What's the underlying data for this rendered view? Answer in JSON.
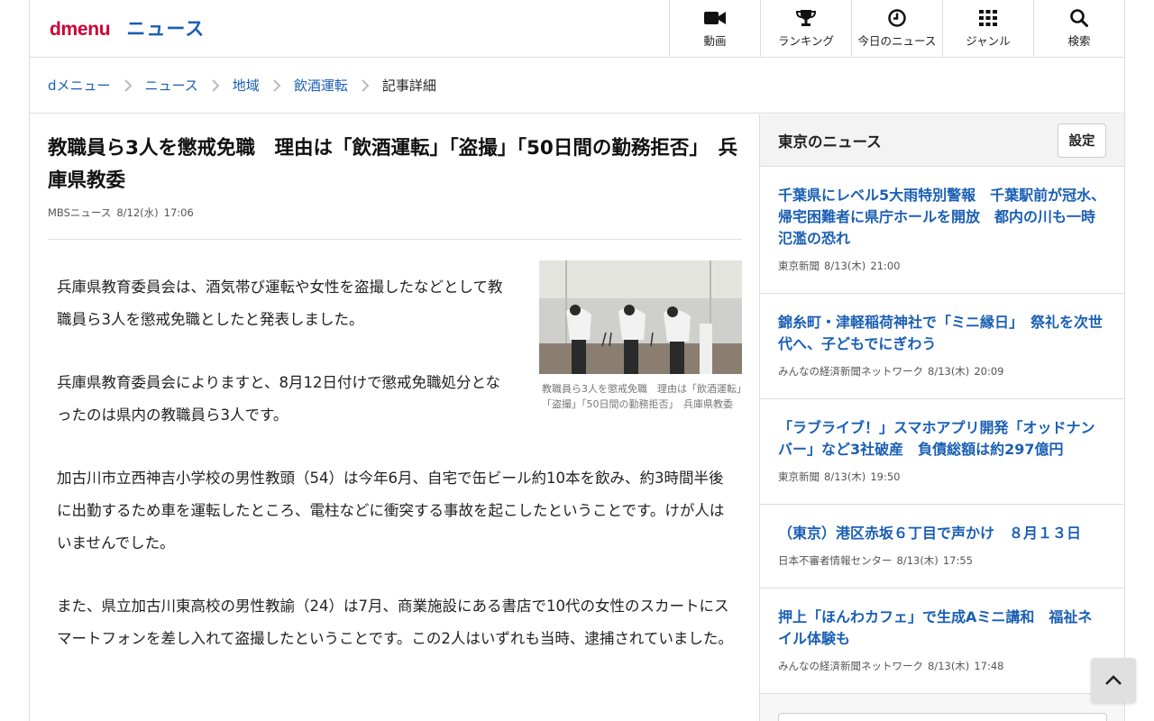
{
  "header": {
    "logo": "dmenu",
    "section": "ニュース",
    "nav": [
      {
        "label": "動画",
        "icon": "video-camera-icon"
      },
      {
        "label": "ランキング",
        "icon": "trophy-icon"
      },
      {
        "label": "今日のニュース",
        "icon": "clock-icon"
      },
      {
        "label": "ジャンル",
        "icon": "grid-icon"
      },
      {
        "label": "検索",
        "icon": "search-icon"
      }
    ]
  },
  "breadcrumb": [
    "dメニュー",
    "ニュース",
    "地域",
    "飲酒運転",
    "記事詳細"
  ],
  "article": {
    "headline": "教職員ら3人を懲戒免職　理由は「飲酒運転」「盗撮」「50日間の勤務拒否」　兵庫県教委",
    "source": "MBSニュース",
    "date": "8/12(水)",
    "time": "17:06",
    "image_caption": "教職員ら3人を懲戒免職　理由は「飲酒運転」「盗撮」「50日間の勤務拒否」　兵庫県教委",
    "paragraphs": [
      "兵庫県教育委員会は、酒気帯び運転や女性を盗撮したなどとして教職員ら3人を懲戒免職としたと発表しました。",
      "兵庫県教育委員会によりますと、8月12日付けで懲戒免職処分となったのは県内の教職員ら3人です。",
      "加古川市立西神吉小学校の男性教頭（54）は今年6月、自宅で缶ビール約10本を飲み、約3時間半後に出勤するため車を運転したところ、電柱などに衝突する事故を起こしたということです。けが人はいませんでした。",
      "また、県立加古川東高校の男性教諭（24）は7月、商業施設にある書店で10代の女性のスカートにスマートフォンを差し入れて盗撮したということです。この2人はいずれも当時、逮捕されていました。"
    ]
  },
  "sidebar": {
    "title": "東京のニュース",
    "settings_label": "設定",
    "items": [
      {
        "title": "千葉県にレベル5大雨特別警報　千葉駅前が冠水、帰宅困難者に県庁ホールを開放　都内の川も一時氾濫の恐れ",
        "source": "東京新聞",
        "date": "8/13(木)",
        "time": "21:00"
      },
      {
        "title": "錦糸町・津軽稲荷神社で「ミニ縁日」　祭礼を次世代へ、子どもでにぎわう",
        "source": "みんなの経済新聞ネットワーク",
        "date": "8/13(木)",
        "time": "20:09"
      },
      {
        "title": "「ラブライブ！」スマホアプリ開発「オッドナンバー」など3社破産　負債総額は約297億円",
        "source": "東京新聞",
        "date": "8/13(木)",
        "time": "19:50"
      },
      {
        "title": "（東京）港区赤坂６丁目で声かけ　８月１３日",
        "source": "日本不審者情報センター",
        "date": "8/13(木)",
        "time": "17:55"
      },
      {
        "title": "押上「ほんわカフェ」で生成Aミニ講和　福祉ネイル体験も",
        "source": "みんなの経済新聞ネットワーク",
        "date": "8/13(木)",
        "time": "17:48"
      }
    ]
  },
  "colors": {
    "brand": "#cc0033",
    "link": "#1a5fb4"
  }
}
